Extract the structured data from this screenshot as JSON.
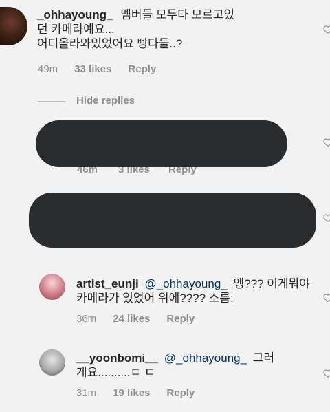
{
  "comments": [
    {
      "username": "_ohhayoung_",
      "line1": "멤버들 모두다 모르고있",
      "line2": "던 카메라예요...",
      "line3": "어디올라와있었어요 빵다들..?",
      "time": "49m",
      "likes": "33 likes",
      "reply": "Reply"
    },
    {
      "username": "artist_eunji",
      "mention": "@_ohhayoung_",
      "line1_rest": "엥??? 이게뭐야",
      "line2": "카메라가 있었어 위에???? 소름;",
      "time": "36m",
      "likes": "24 likes",
      "reply": "Reply"
    },
    {
      "username": "__yoonbomi__",
      "mention": "@_ohhayoung_",
      "line1_rest": "그러",
      "line2": "게요..........ㄷ ㄷ",
      "time": "31m",
      "likes": "19 likes",
      "reply": "Reply"
    }
  ],
  "hide_replies": "Hide replies",
  "hidden_meta": {
    "time": "46m",
    "likes": "3 likes",
    "reply": "Reply"
  },
  "colors": {
    "background": "#f2f2f2",
    "text": "#262626",
    "secondary": "#8e8e8e",
    "mention": "#00376b",
    "redaction": "#2a2d30"
  }
}
